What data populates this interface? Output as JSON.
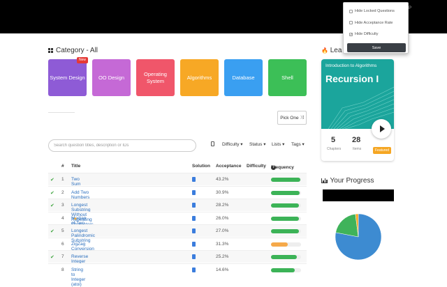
{
  "category": {
    "title": "Category - All",
    "cards": [
      {
        "label": "System Design",
        "color": "#8e5bd6",
        "badge": "New"
      },
      {
        "label": "OO Design",
        "color": "#c569d6"
      },
      {
        "label": "Operating System",
        "color": "#f0566a"
      },
      {
        "label": "Algorithms",
        "color": "#f7a825"
      },
      {
        "label": "Database",
        "color": "#3a9ff1"
      },
      {
        "label": "Shell",
        "color": "#3cbf57"
      }
    ]
  },
  "pick_one": "Pick One",
  "search": {
    "placeholder": "Search question titles, description or IDs"
  },
  "filters": {
    "difficulty": "Difficulty",
    "status": "Status",
    "lists": "Lists",
    "tags": "Tags"
  },
  "table": {
    "headers": {
      "num": "#",
      "title": "Title",
      "solution": "Solution",
      "acceptance": "Acceptance",
      "difficulty": "Difficulty",
      "frequency": "Frequency"
    },
    "rows": [
      {
        "solved": true,
        "num": "1",
        "title": "Two Sum",
        "starred": false,
        "acceptance": "43.2%",
        "freq": 0.97,
        "freq_color": "#3cb357"
      },
      {
        "solved": true,
        "num": "2",
        "title": "Add Two Numbers",
        "starred": false,
        "acceptance": "30.9%",
        "freq": 0.95,
        "freq_color": "#3cb357"
      },
      {
        "solved": true,
        "num": "3",
        "title": "Longest Substring Without Repeating Characters",
        "starred": false,
        "acceptance": "28.2%",
        "freq": 0.92,
        "freq_color": "#3cb357"
      },
      {
        "solved": false,
        "num": "4",
        "title": "Median of Two Sorted Arrays",
        "starred": true,
        "acceptance": "26.0%",
        "freq": 0.92,
        "freq_color": "#3cb357"
      },
      {
        "solved": true,
        "num": "5",
        "title": "Longest Palindromic Substring",
        "starred": false,
        "acceptance": "27.0%",
        "freq": 0.92,
        "freq_color": "#3cb357"
      },
      {
        "solved": false,
        "num": "6",
        "title": "ZigZag Conversion",
        "starred": false,
        "acceptance": "31.3%",
        "freq": 0.55,
        "freq_color": "#f5a94a"
      },
      {
        "solved": true,
        "num": "7",
        "title": "Reverse Integer",
        "starred": false,
        "acceptance": "25.2%",
        "freq": 0.85,
        "freq_color": "#3cb357"
      },
      {
        "solved": false,
        "num": "8",
        "title": "String to Integer (atoi)",
        "starred": false,
        "acceptance": "14.6%",
        "freq": 0.78,
        "freq_color": "#3cb357"
      }
    ]
  },
  "explore": {
    "title_fragment": "Lea",
    "course_subtitle": "Introduction to Algorithms",
    "course_title": "Recursion I",
    "chapters_value": "5",
    "chapters_label": "Chapters",
    "items_value": "28",
    "items_label": "Items",
    "featured": "Featured"
  },
  "progress": {
    "title": "Your Progress",
    "pie": [
      {
        "fraction": 0.78,
        "color": "#3d8bd1"
      },
      {
        "fraction": 0.2,
        "color": "#3fb35a"
      },
      {
        "fraction": 0.02,
        "color": "#f5a623"
      }
    ]
  },
  "dropdown": {
    "items": [
      {
        "label": "Hide Locked Questions",
        "checked": false
      },
      {
        "label": "Hide Acceptance Rate",
        "checked": false
      },
      {
        "label": "Hide Difficulty",
        "checked": true
      }
    ],
    "save": "Save"
  }
}
